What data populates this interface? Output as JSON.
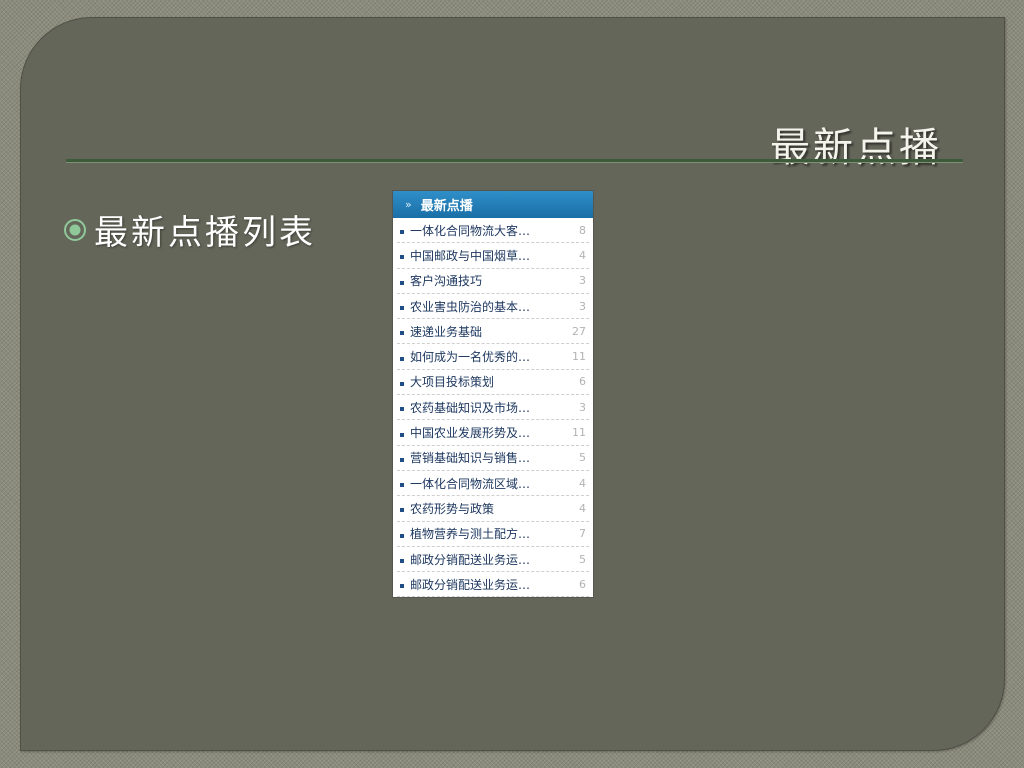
{
  "slide": {
    "title": "最新点播",
    "bullet": "最新点播列表"
  },
  "widget": {
    "header_arrow": "»",
    "header_title": "最新点播",
    "items": [
      {
        "title": "一体化合同物流大客…",
        "count": "8"
      },
      {
        "title": "中国邮政与中国烟草…",
        "count": "4"
      },
      {
        "title": "客户沟通技巧",
        "count": "3"
      },
      {
        "title": "农业害虫防治的基本…",
        "count": "3"
      },
      {
        "title": "速递业务基础",
        "count": "27"
      },
      {
        "title": "如何成为一名优秀的…",
        "count": "11"
      },
      {
        "title": "大项目投标策划",
        "count": "6"
      },
      {
        "title": "农药基础知识及市场…",
        "count": "3"
      },
      {
        "title": "中国农业发展形势及…",
        "count": "11"
      },
      {
        "title": "营销基础知识与销售…",
        "count": "5"
      },
      {
        "title": "一体化合同物流区域…",
        "count": "4"
      },
      {
        "title": "农药形势与政策",
        "count": "4"
      },
      {
        "title": "植物营养与测土配方…",
        "count": "7"
      },
      {
        "title": "邮政分销配送业务运…",
        "count": "5"
      },
      {
        "title": "邮政分销配送业务运…",
        "count": "6"
      }
    ]
  },
  "colors": {
    "background": "#65665a",
    "title_text": "#f4f4ec",
    "rule": "#3c5b3a",
    "widget_header": "#1b6ea6",
    "item_text": "#1e3860",
    "item_count": "#b3b3b3"
  },
  "icons": {
    "bullet": "target-bullet-icon",
    "header": "double-chevron-right-icon",
    "item": "square-bullet-icon"
  }
}
